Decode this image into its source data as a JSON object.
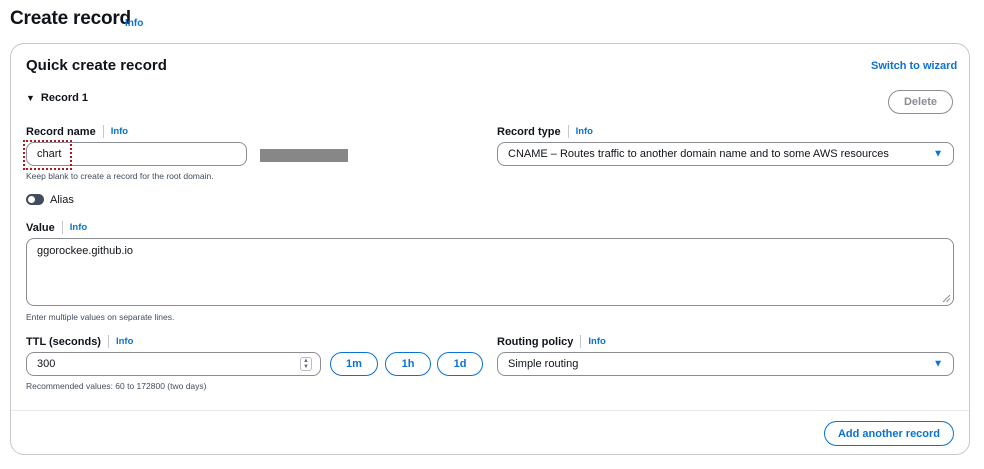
{
  "header": {
    "title": "Create record",
    "info": "Info"
  },
  "card": {
    "title": "Quick create record",
    "switch_link": "Switch to wizard"
  },
  "record": {
    "toggle_label": "Record 1",
    "caret": "▼",
    "delete_label": "Delete"
  },
  "record_name": {
    "label": "Record name",
    "info": "Info",
    "value": "chart",
    "hint": "Keep blank to create a record for the root domain."
  },
  "record_type": {
    "label": "Record type",
    "info": "Info",
    "selected": "CNAME – Routes traffic to another domain name and to some AWS resources"
  },
  "alias": {
    "label": "Alias",
    "enabled": false
  },
  "value_field": {
    "label": "Value",
    "info": "Info",
    "value": "ggorockee.github.io",
    "hint": "Enter multiple values on separate lines."
  },
  "ttl": {
    "label": "TTL (seconds)",
    "info": "Info",
    "value": "300",
    "hint": "Recommended values: 60 to 172800 (two days)",
    "presets": [
      "1m",
      "1h",
      "1d"
    ]
  },
  "routing_policy": {
    "label": "Routing policy",
    "info": "Info",
    "selected": "Simple routing"
  },
  "footer": {
    "add_label": "Add another record"
  },
  "colors": {
    "accent": "#0972d3",
    "border": "#8c8c94",
    "focus": "#b0161c"
  }
}
